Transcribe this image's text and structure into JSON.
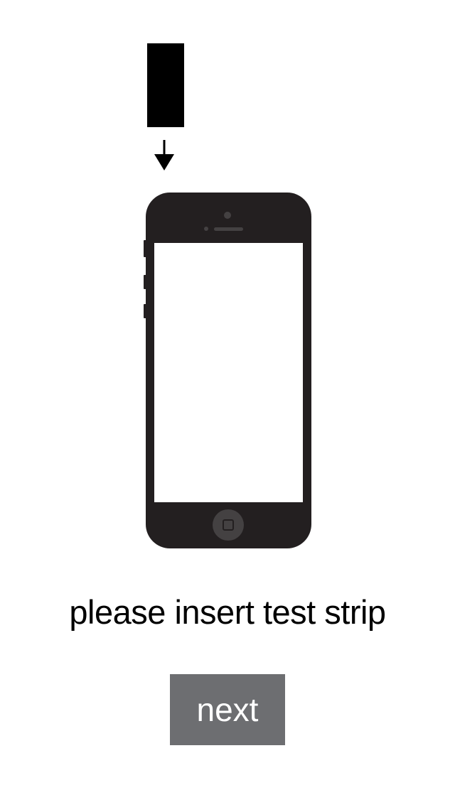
{
  "illustration": {
    "strip_icon": "test-strip-icon",
    "arrow_icon": "arrow-down-icon",
    "phone_icon": "smartphone-icon",
    "home_button_icon": "home-button-icon",
    "colors": {
      "strip": "#000000",
      "phone_body": "#231f20",
      "phone_detail": "#444142",
      "screen": "#ffffff"
    }
  },
  "instruction": {
    "text": "please insert test strip"
  },
  "next_button": {
    "label": "next",
    "background": "#6d6e71",
    "text_color": "#ffffff"
  }
}
